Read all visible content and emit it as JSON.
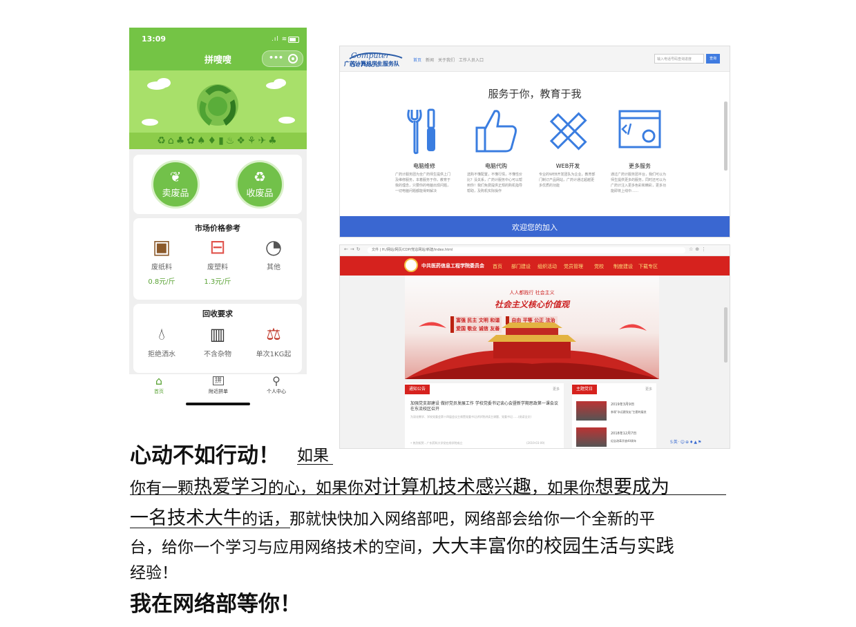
{
  "phone": {
    "time": "13:09",
    "app_title": "拼嗖嗖",
    "capsule_dots": "•••",
    "sell_label": "卖废品",
    "buy_label": "收废品",
    "market_title": "市场价格参考",
    "market_items": [
      {
        "label": "废纸料",
        "price": "0.8元/斤",
        "icon": "cardboard-box-icon"
      },
      {
        "label": "废塑料",
        "price": "1.3元/斤",
        "icon": "plastic-basket-icon"
      },
      {
        "label": "其他",
        "price": "",
        "icon": "pie-chart-icon"
      }
    ],
    "req_title": "回收要求",
    "req_items": [
      {
        "label": "拒绝洒水",
        "icon": "water-drop-icon"
      },
      {
        "label": "不含杂物",
        "icon": "trash-bin-icon"
      },
      {
        "label": "单次1KG起",
        "icon": "scale-icon"
      }
    ],
    "tabs": [
      {
        "label": "首页",
        "icon": "home-icon"
      },
      {
        "label": "附近拼单",
        "icon": "group-order-icon"
      },
      {
        "label": "个人中心",
        "icon": "user-icon"
      }
    ],
    "tab_glyph": "拼"
  },
  "web1": {
    "logo_text": "广药计算机学生服务队",
    "logo_script": "Computer Service",
    "nav": [
      "首页",
      "新闻",
      "关于我们",
      "工作人员入口"
    ],
    "search_placeholder": "输入电话号码查询进度",
    "search_button": "查询",
    "heading": "服务于你，教育于我",
    "services": [
      {
        "title": "电脑维修",
        "desc": "广药计服务团为全广药师生提供上门及维修服务，本着服务于你，教育于我的理念，只要你的电脑出现问题，一切电脑问题都能得到解决"
      },
      {
        "title": "电脑代购",
        "desc": "选购不懂配置，不懂行情，不懂性价比？没关系，广药计服务中心可以帮到你！我们免费提供正规的购机指导帮助，及购机实际操作"
      },
      {
        "title": "WEB开发",
        "desc": "专业的WEB开发团队为企业，教育部门制订产品网站，广药计通过超越更多优质的功能"
      },
      {
        "title": "更多服务",
        "desc": "通过广药计服务团平台，我们可以为师生提供更多的服务，同时还可以为广药计注入更多色彩和精彩，更多功能即将上线中……"
      }
    ],
    "footer": "欢迎您的加入"
  },
  "web2": {
    "url": "文件 | H:/网站/网页/CDP/党总网站/新建/index.html",
    "site_name": "中共医药信息工程学院委员会",
    "nav": [
      "首页",
      "部门建设",
      "组织活动",
      "党员管理",
      "党校",
      "制度建设",
      "下载专区"
    ],
    "banner_slogan_small": "人人都践行 社会主义",
    "banner_slogan_big": "社会主义核心价值观",
    "banner_values": [
      "富强 民主 文明 和谐",
      "自由 平等 公正 法治",
      "爱国 敬业 诚信 友善"
    ],
    "notice_title": "通知公告",
    "notice_more": "更多",
    "notice_headline": "加强党支部建设 做好党员发展工作 学校党委书记谈心会暨新学期思政第一课会议在东流校区召开",
    "notice_text": "为深化教学、学校党委会第十四届会议主席暨党委书记讲学院讲读主课题、党委书记……(阅读全文)",
    "notice_item": "• 热烈祝贺...广东药科大学党在线学院成立",
    "notice_date": "(2019-03-09)",
    "topic_title": "主题党日",
    "topic_more": "更多",
    "topic_items": [
      {
        "date": "2019年3月9日",
        "text": "参观\"永远跟党走\"主题的展览"
      },
      {
        "date": "2018年12月7日",
        "text": "纪念改革开放40周年"
      }
    ]
  },
  "text": {
    "l1_bold": "心动不如行动！",
    "l1_tail": "如果",
    "l2_a": "你有一颗",
    "l2_b": "热爱学习",
    "l2_c": "的心，如果你",
    "l2_d": "对计算机技术感兴趣",
    "l2_e": "，如果你",
    "l2_f": "想要成为",
    "l3_a": "一名技术大牛",
    "l3_b": "的话，那就快快加入网络部吧，网络部会给你一个全新的平",
    "l4_a": "台，给你一个学习与应用网络技术的空间，",
    "l4_b": "大大丰富你的校园生活与实践",
    "l5": "经验！",
    "l6": "我在网络部等你！"
  },
  "colors": {
    "phone_green": "#74c445",
    "web1_blue": "#3a67d1",
    "web2_red": "#d6221e"
  }
}
